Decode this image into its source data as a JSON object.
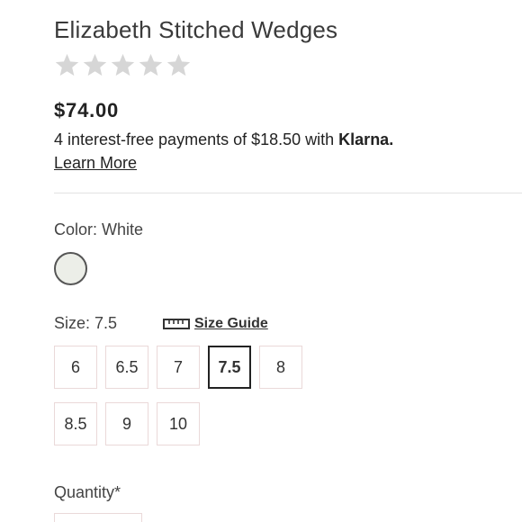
{
  "product": {
    "title": "Elizabeth Stitched Wedges",
    "rating": 0,
    "rating_max": 5,
    "price": "$74.00"
  },
  "klarna": {
    "text": "4 interest-free payments of $18.50 with ",
    "brand": "Klarna.",
    "learn_more": "Learn More"
  },
  "color": {
    "label": "Color: White",
    "swatch_color": "#eceee8"
  },
  "size": {
    "label": "Size: 7.5",
    "guide_label": "Size Guide",
    "options": [
      "6",
      "6.5",
      "7",
      "7.5",
      "8",
      "8.5",
      "9",
      "10"
    ],
    "selected": "7.5"
  },
  "quantity": {
    "label": "Quantity*"
  },
  "colors": {
    "star_empty": "#d6d6d6",
    "border_light": "#ead9d9",
    "selected_border": "#222222"
  }
}
